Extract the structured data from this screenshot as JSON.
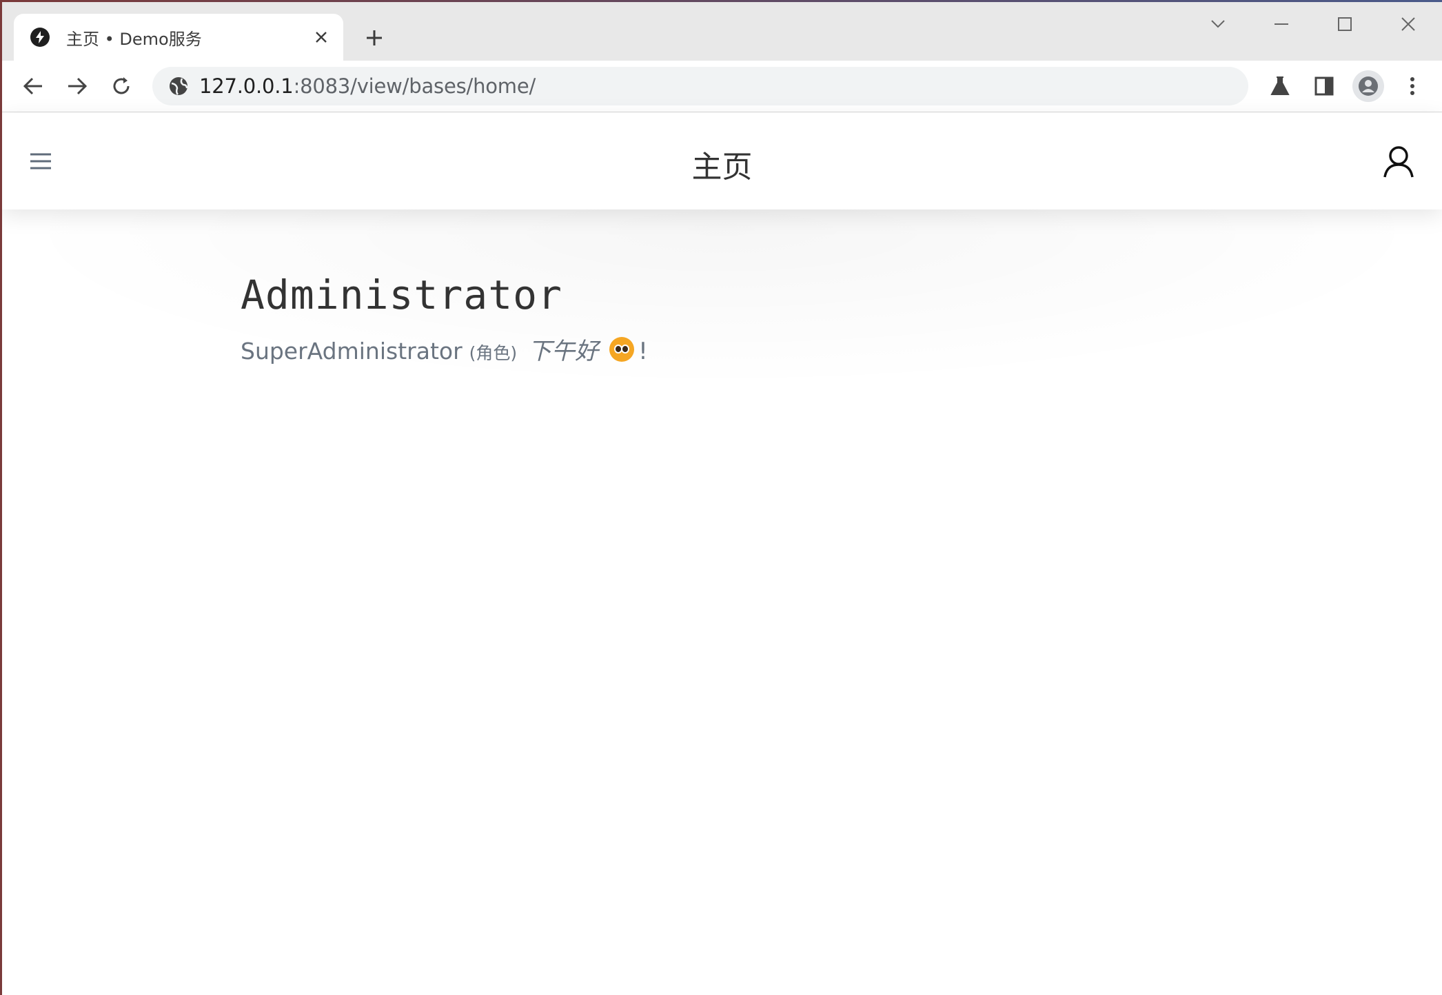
{
  "browser": {
    "tab_title": "主页 • Demo服务",
    "url_host": "127.0.0.1",
    "url_rest": ":8083/view/bases/home/"
  },
  "app": {
    "page_title": "主页",
    "user_name": "Administrator",
    "role_name": "SuperAdministrator",
    "role_suffix": "(角色)",
    "greeting": "下午好",
    "exclaim": "!"
  },
  "colors": {
    "accent": "#1f1f1f",
    "muted_text": "#6a7480",
    "emoji": "#f5a623"
  },
  "icons": [
    "lightning-icon",
    "close-icon",
    "plus-icon",
    "chevron-down-icon",
    "minimize-icon",
    "maximize-icon",
    "back-icon",
    "forward-icon",
    "reload-icon",
    "site-info-icon",
    "labs-icon",
    "side-panel-icon",
    "profile-icon",
    "more-icon",
    "hamburger-icon",
    "user-icon"
  ]
}
